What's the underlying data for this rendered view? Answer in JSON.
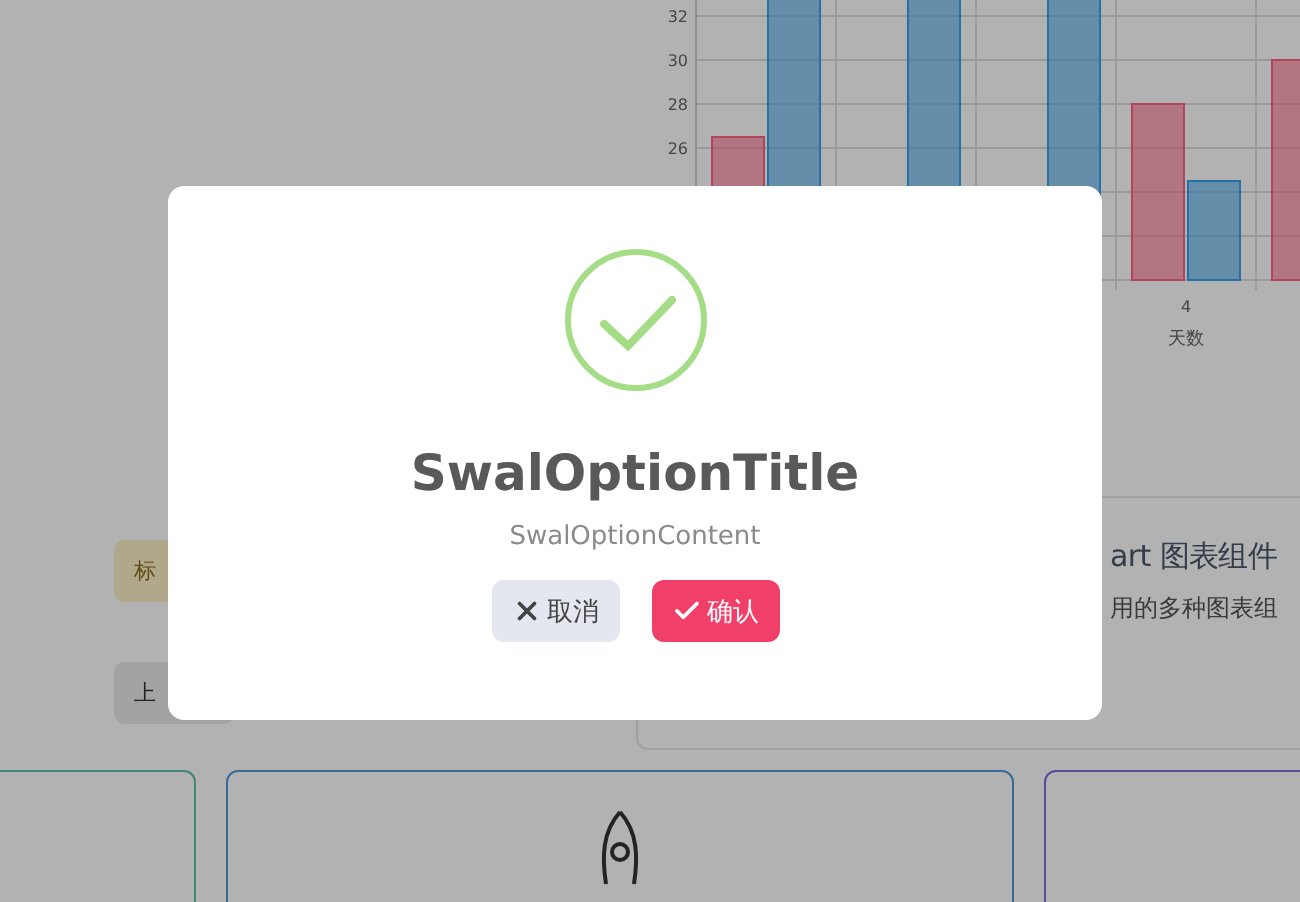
{
  "background": {
    "tag": {
      "label": "标"
    },
    "upload_button": {
      "label": "上"
    },
    "chart": {
      "y_tick_labels": [
        "32",
        "30",
        "28",
        "26"
      ],
      "x_tick_label": "4",
      "axis_title": "天数"
    },
    "chart_card": {
      "title": "art 图表组件",
      "description": "用的多种图表组"
    },
    "cards": [
      {
        "kind": "plain"
      },
      {
        "kind": "rocket"
      },
      {
        "kind": "plain"
      }
    ]
  },
  "dialog": {
    "title": "SwalOptionTitle",
    "content": "SwalOptionContent",
    "buttons": [
      {
        "kind": "cancel",
        "label": "取消"
      },
      {
        "kind": "confirm",
        "label": "确认"
      }
    ]
  }
}
